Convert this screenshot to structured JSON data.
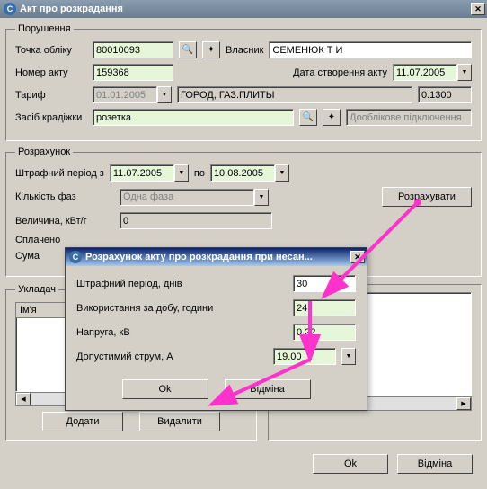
{
  "window": {
    "title": "Акт про розкрадання"
  },
  "violation": {
    "legend": "Порушення",
    "account_label": "Точка обліку",
    "account_value": "80010093",
    "owner_label": "Власник",
    "owner_value": "СЕМЕНЮК Т И",
    "act_no_label": "Номер акту",
    "act_no_value": "159368",
    "act_date_label": "Дата створення акту",
    "act_date_value": "11.07.2005",
    "tariff_label": "Тариф",
    "tariff_date": "01.01.2005",
    "tariff_name": "ГОРОД, ГАЗ.ПЛИТЫ",
    "tariff_rate": "0.1300",
    "theft_label": "Засіб крадіжки",
    "theft_value": "розетка",
    "preacct_conn": "Дооблікове підключення"
  },
  "calc": {
    "legend": "Розрахунок",
    "period_label": "Штрафний період  з",
    "period_from": "11.07.2005",
    "period_to_label": "по",
    "period_to": "10.08.2005",
    "phase_label": "Кількість фаз",
    "phase_value": "Одна фаза",
    "calc_btn": "Розрахувати",
    "mag_label": "Величина, кВт/г",
    "mag_value": "0",
    "paid_label": "Сплачено",
    "sum_label": "Сума"
  },
  "signer": {
    "legend": "Укладач",
    "name_header": "Ім'я",
    "add_btn": "Додати",
    "del_btn": "Видалити"
  },
  "footer": {
    "ok": "Ok",
    "cancel": "Відміна"
  },
  "modal": {
    "title": "Розрахунок акту про розкрадання при несан...",
    "days_label": "Штрафний період, днів",
    "days_value": "30",
    "usage_label": "Використання за добу, години",
    "usage_value": "24",
    "voltage_label": "Напруга, кВ",
    "voltage_value": "0.22",
    "current_label": "Допустимий струм, А",
    "current_value": "19.00",
    "ok": "Ok",
    "cancel": "Відміна"
  }
}
